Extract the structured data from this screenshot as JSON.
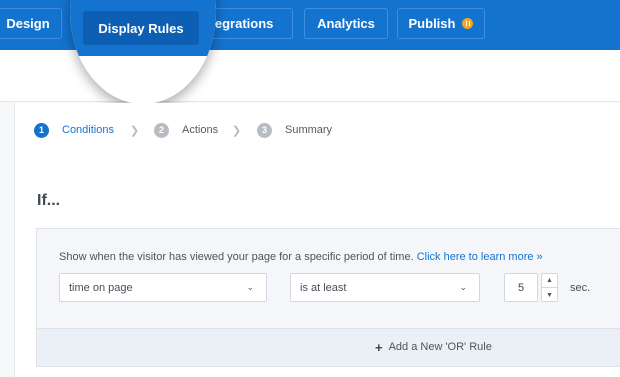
{
  "nav": {
    "tabs": [
      {
        "label": "Design"
      },
      {
        "label": "Display Rules"
      },
      {
        "label": "Integrations"
      },
      {
        "label": "Analytics"
      },
      {
        "label": "Publish"
      }
    ],
    "integrations_visible": "ntegrations",
    "active_tab": "Display Rules"
  },
  "steps": [
    {
      "num": "1",
      "label": "Conditions"
    },
    {
      "num": "2",
      "label": "Actions"
    },
    {
      "num": "3",
      "label": "Summary"
    }
  ],
  "heading": "If...",
  "rule": {
    "description": "Show when the visitor has viewed your page for a specific period of time.",
    "learn_more": "Click here to learn more »",
    "metric": "time on page",
    "operator": "is at least",
    "value": "5",
    "unit": "sec."
  },
  "or_rule_label": "Add a New 'OR' Rule",
  "colors": {
    "brand": "#1473cf",
    "publish_badge": "#f4a622"
  }
}
